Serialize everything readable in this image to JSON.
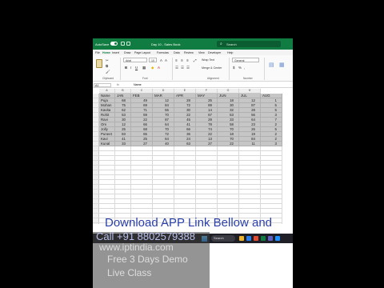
{
  "titlebar": {
    "autosave_label": "AutoSave",
    "file_title": "Day 10 - Sales Book",
    "search_placeholder": "Search"
  },
  "tabs": [
    "File",
    "Home",
    "Insert",
    "Draw",
    "Page Layout",
    "Formulas",
    "Data",
    "Review",
    "View",
    "Developer",
    "Help"
  ],
  "ribbon": {
    "font_name": "Arial",
    "font_size": "10",
    "wrap_text": "Wrap Text",
    "merge_center": "Merge & Center",
    "number_format": "General",
    "groups": [
      "Clipboard",
      "Font",
      "Alignment",
      "Number"
    ]
  },
  "formula_bar": {
    "name_box": "A1",
    "fx": "fx",
    "content": "Name"
  },
  "columns": [
    "A",
    "B",
    "C",
    "D",
    "E",
    "F",
    "G",
    "H"
  ],
  "table": {
    "headers": [
      "Name",
      "JAN",
      "FEB",
      "MAR",
      "APR",
      "MAY",
      "JUN",
      "JUL",
      "AUG"
    ],
    "rows": [
      [
        "Puja",
        "68",
        "49",
        "12",
        "28",
        "25",
        "18",
        "12",
        "1"
      ],
      [
        "Mohan",
        "75",
        "69",
        "84",
        "72",
        "89",
        "30",
        "87",
        "5"
      ],
      [
        "Kavita",
        "62",
        "71",
        "55",
        "30",
        "14",
        "32",
        "28",
        "5"
      ],
      [
        "Rohit",
        "53",
        "59",
        "70",
        "22",
        "67",
        "53",
        "56",
        "3"
      ],
      [
        "Ravi",
        "30",
        "22",
        "87",
        "45",
        "29",
        "33",
        "64",
        "7"
      ],
      [
        "Om",
        "12",
        "66",
        "64",
        "41",
        "78",
        "58",
        "23",
        "2"
      ],
      [
        "Jolly",
        "25",
        "68",
        "70",
        "66",
        "74",
        "70",
        "26",
        "5"
      ],
      [
        "Puneet",
        "83",
        "65",
        "72",
        "36",
        "22",
        "18",
        "19",
        "2"
      ],
      [
        "Kavi",
        "41",
        "25",
        "64",
        "24",
        "13",
        "70",
        "84",
        "2"
      ],
      [
        "Kunal",
        "33",
        "27",
        "40",
        "63",
        "27",
        "22",
        "11",
        "3"
      ]
    ]
  },
  "taskbar": {
    "search": "Search"
  },
  "overlay": {
    "line1": "Download APP Link Bellow and",
    "line2": "Call +91 8802579388",
    "line3": "www.iptindia.com",
    "line4": "Free 3 Days Demo",
    "line5": "Live Class"
  }
}
